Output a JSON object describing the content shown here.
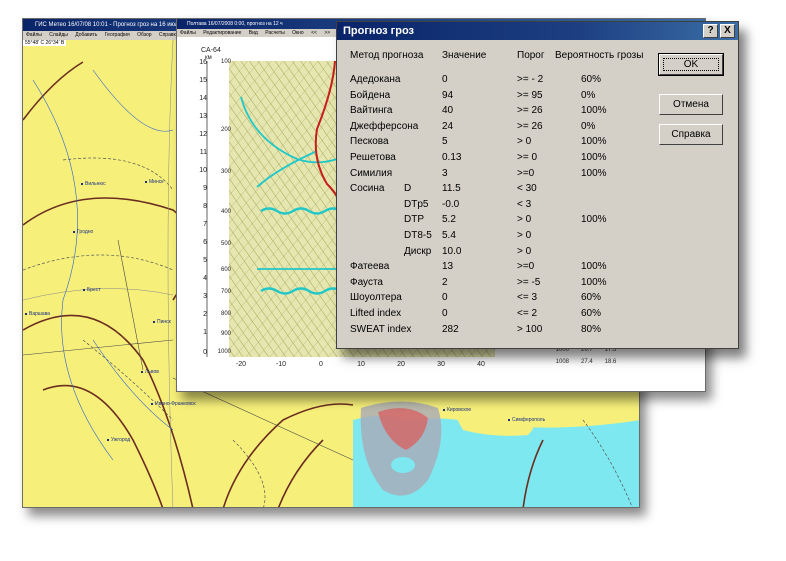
{
  "map_window": {
    "title": "ГИС Метео 16/07/08 10:01 - Прогноз гроз на 16 июля",
    "menu": [
      "Файлы",
      "Слайды",
      "Добавить",
      "География",
      "Обзор",
      "Справка"
    ],
    "coord": "55°48' С 26°34' В",
    "cities": [
      "Вильнюс",
      "Минск",
      "Гродно",
      "Брест",
      "Варшава",
      "Пинск",
      "Львов",
      "Ивано-Франковск",
      "Ужгород",
      "Кировское",
      "Симферополь"
    ]
  },
  "sounding_window": {
    "title": "Полтава 16/07/2008 0:00, прогноз на 12 ч",
    "menu": [
      "Файлы",
      "Редактирование",
      "Вид",
      "Расчеты",
      "Окно",
      "<<",
      ">>"
    ],
    "station": "CA-64",
    "alt_unit": "км",
    "alt_ticks": [
      "16",
      "15",
      "14",
      "13",
      "12",
      "11",
      "10",
      "9",
      "8",
      "7",
      "6",
      "5",
      "4",
      "3",
      "2",
      "1",
      "0"
    ],
    "pressure_ticks": [
      "100",
      "200",
      "300",
      "400",
      "500",
      "600",
      "700",
      "800",
      "900",
      "1000"
    ],
    "temp_ticks": [
      "-20",
      "-10",
      "0",
      "10",
      "20",
      "30",
      "40"
    ],
    "surface_rows": [
      {
        "p": "1000",
        "t": "26.7",
        "td": "17.3"
      },
      {
        "p": "1008",
        "t": "27.4",
        "td": "18.6"
      }
    ]
  },
  "dialog": {
    "title": "Прогноз гроз",
    "help_btn": "?",
    "close_btn": "X",
    "headers": {
      "method": "Метод прогноза",
      "value": "Значение",
      "threshold": "Порог",
      "probability": "Вероятность грозы"
    },
    "rows": [
      {
        "method": "Адедокана",
        "sub": "",
        "value": "0",
        "threshold": ">= - 2",
        "prob": "60%"
      },
      {
        "method": "Бойдена",
        "sub": "",
        "value": "94",
        "threshold": ">= 95",
        "prob": "0%"
      },
      {
        "method": "Вайтинга",
        "sub": "",
        "value": "40",
        "threshold": ">= 26",
        "prob": "100%"
      },
      {
        "method": "Джефферсона",
        "sub": "",
        "value": "24",
        "threshold": ">= 26",
        "prob": "0%"
      },
      {
        "method": "Пескова",
        "sub": "",
        "value": "5",
        "threshold": ">  0",
        "prob": "100%"
      },
      {
        "method": "Решетова",
        "sub": "",
        "value": "0.13",
        "threshold": ">=  0",
        "prob": "100%"
      },
      {
        "method": "Симилия",
        "sub": "",
        "value": "3",
        "threshold": ">=0",
        "prob": "100%"
      },
      {
        "method": "Сосина",
        "sub": "D",
        "value": "11.5",
        "threshold": "< 30",
        "prob": ""
      },
      {
        "method": "",
        "sub": "DTp5",
        "value": "-0.0",
        "threshold": "< 3",
        "prob": ""
      },
      {
        "method": "",
        "sub": "DTP",
        "value": "5.2",
        "threshold": "> 0",
        "prob": "100%"
      },
      {
        "method": "",
        "sub": "DT8-5",
        "value": "5.4",
        "threshold": "> 0",
        "prob": ""
      },
      {
        "method": "",
        "sub": "Дискр",
        "value": "10.0",
        "threshold": "> 0",
        "prob": ""
      },
      {
        "method": "Фатеева",
        "sub": "",
        "value": "13",
        "threshold": ">=0",
        "prob": "100%"
      },
      {
        "method": "Фауста",
        "sub": "",
        "value": "2",
        "threshold": ">= -5",
        "prob": "100%"
      },
      {
        "method": "Шоуолтера",
        "sub": "",
        "value": "0",
        "threshold": "<= 3",
        "prob": "60%"
      },
      {
        "method": "Lifted index",
        "sub": "",
        "value": "0",
        "threshold": "<= 2",
        "prob": "60%"
      },
      {
        "method": "SWEAT index",
        "sub": "",
        "value": "282",
        "threshold": "> 100",
        "prob": "80%"
      }
    ],
    "buttons": {
      "ok": "OK",
      "cancel": "Отмена",
      "help": "Справка"
    }
  }
}
